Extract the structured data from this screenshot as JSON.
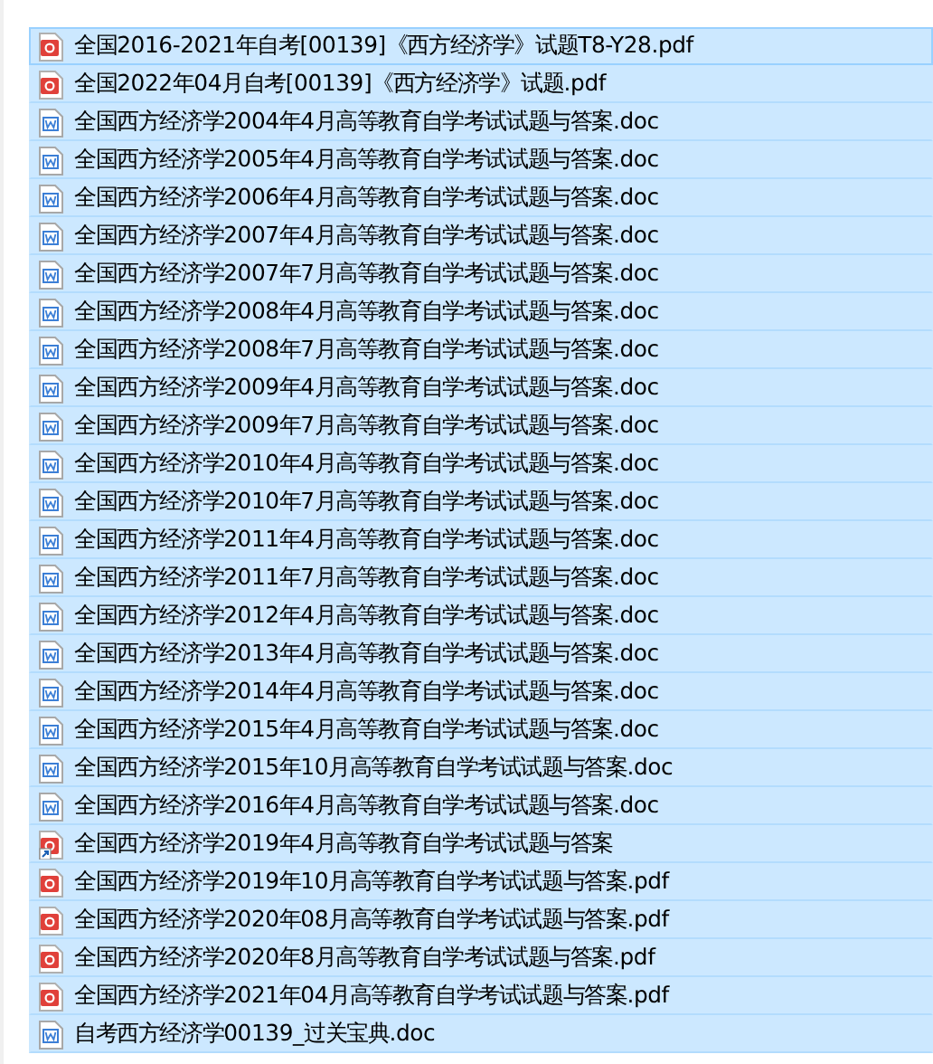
{
  "files": [
    {
      "name": "全国2016-2021年自考[00139]《西方经济学》试题T8-Y28.pdf",
      "kind": "pdf",
      "selected": true,
      "focused": true
    },
    {
      "name": "全国2022年04月自考[00139]《西方经济学》试题.pdf",
      "kind": "pdf",
      "selected": true,
      "focused": false
    },
    {
      "name": "全国西方经济学2004年4月高等教育自学考试试题与答案.doc",
      "kind": "doc",
      "selected": true,
      "focused": false
    },
    {
      "name": "全国西方经济学2005年4月高等教育自学考试试题与答案.doc",
      "kind": "doc",
      "selected": true,
      "focused": false
    },
    {
      "name": "全国西方经济学2006年4月高等教育自学考试试题与答案.doc",
      "kind": "doc",
      "selected": true,
      "focused": false
    },
    {
      "name": "全国西方经济学2007年4月高等教育自学考试试题与答案.doc",
      "kind": "doc",
      "selected": true,
      "focused": false
    },
    {
      "name": "全国西方经济学2007年7月高等教育自学考试试题与答案.doc",
      "kind": "doc",
      "selected": true,
      "focused": false
    },
    {
      "name": "全国西方经济学2008年4月高等教育自学考试试题与答案.doc",
      "kind": "doc",
      "selected": true,
      "focused": false
    },
    {
      "name": "全国西方经济学2008年7月高等教育自学考试试题与答案.doc",
      "kind": "doc",
      "selected": true,
      "focused": false
    },
    {
      "name": "全国西方经济学2009年4月高等教育自学考试试题与答案.doc",
      "kind": "doc",
      "selected": true,
      "focused": false
    },
    {
      "name": "全国西方经济学2009年7月高等教育自学考试试题与答案.doc",
      "kind": "doc",
      "selected": true,
      "focused": false
    },
    {
      "name": "全国西方经济学2010年4月高等教育自学考试试题与答案.doc",
      "kind": "doc",
      "selected": true,
      "focused": false
    },
    {
      "name": "全国西方经济学2010年7月高等教育自学考试试题与答案.doc",
      "kind": "doc",
      "selected": true,
      "focused": false
    },
    {
      "name": "全国西方经济学2011年4月高等教育自学考试试题与答案.doc",
      "kind": "doc",
      "selected": true,
      "focused": false
    },
    {
      "name": "全国西方经济学2011年7月高等教育自学考试试题与答案.doc",
      "kind": "doc",
      "selected": true,
      "focused": false
    },
    {
      "name": "全国西方经济学2012年4月高等教育自学考试试题与答案.doc",
      "kind": "doc",
      "selected": true,
      "focused": false
    },
    {
      "name": "全国西方经济学2013年4月高等教育自学考试试题与答案.doc",
      "kind": "doc",
      "selected": true,
      "focused": false
    },
    {
      "name": "全国西方经济学2014年4月高等教育自学考试试题与答案.doc",
      "kind": "doc",
      "selected": true,
      "focused": false
    },
    {
      "name": "全国西方经济学2015年4月高等教育自学考试试题与答案.doc",
      "kind": "doc",
      "selected": true,
      "focused": false
    },
    {
      "name": "全国西方经济学2015年10月高等教育自学考试试题与答案.doc",
      "kind": "doc",
      "selected": true,
      "focused": false
    },
    {
      "name": "全国西方经济学2016年4月高等教育自学考试试题与答案.doc",
      "kind": "doc",
      "selected": true,
      "focused": false
    },
    {
      "name": "全国西方经济学2019年4月高等教育自学考试试题与答案",
      "kind": "shortcut",
      "selected": true,
      "focused": false
    },
    {
      "name": "全国西方经济学2019年10月高等教育自学考试试题与答案.pdf",
      "kind": "pdf",
      "selected": true,
      "focused": false
    },
    {
      "name": "全国西方经济学2020年08月高等教育自学考试试题与答案.pdf",
      "kind": "pdf",
      "selected": true,
      "focused": false
    },
    {
      "name": "全国西方经济学2020年8月高等教育自学考试试题与答案.pdf",
      "kind": "pdf",
      "selected": true,
      "focused": false
    },
    {
      "name": "全国西方经济学2021年04月高等教育自学考试试题与答案.pdf",
      "kind": "pdf",
      "selected": true,
      "focused": false
    },
    {
      "name": "自考西方经济学00139_过关宝典.doc",
      "kind": "doc",
      "selected": true,
      "focused": false
    }
  ]
}
